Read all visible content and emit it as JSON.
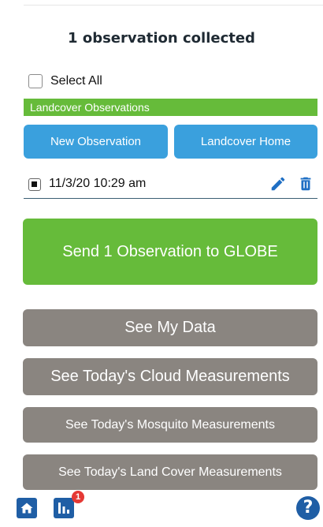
{
  "header": {
    "title": "1 observation collected"
  },
  "select_all": {
    "label": "Select All"
  },
  "section": {
    "title": "Landcover Observations"
  },
  "buttons": {
    "new_observation": "New Observation",
    "landcover_home": "Landcover Home"
  },
  "observations": [
    {
      "label": "11/3/20 10:29 am"
    }
  ],
  "send": {
    "label": "Send 1 Observation to GLOBE"
  },
  "menu": [
    "See My Data",
    "See Today's Cloud Measurements",
    "See Today's Mosquito Measurements",
    "See Today's Land Cover Measurements"
  ],
  "footer": {
    "badge_count": "1",
    "help_label": "?"
  },
  "colors": {
    "green": "#66bb3a",
    "blue": "#3aa0dd",
    "grey": "#8a8580",
    "nav_blue": "#1f5ea5",
    "badge_red": "#e53935"
  }
}
